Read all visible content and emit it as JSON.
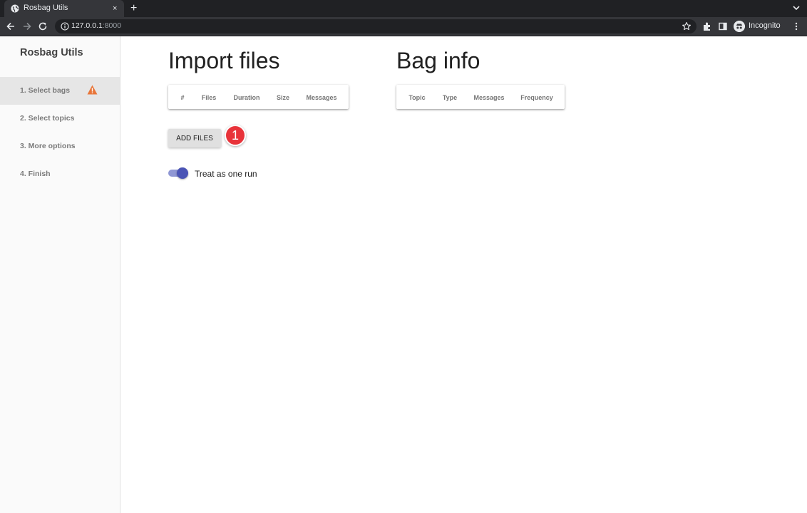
{
  "browser": {
    "tab_title": "Rosbag Utils",
    "tab_close": "×",
    "new_tab": "+",
    "url_host": "127.0.0.1",
    "url_port": ":8000",
    "profile_label": "Incognito"
  },
  "sidebar": {
    "app_title": "Rosbag Utils",
    "steps": [
      {
        "label": "1. Select bags",
        "active": true,
        "warning": true
      },
      {
        "label": "2. Select topics"
      },
      {
        "label": "3. More options"
      },
      {
        "label": "4. Finish"
      }
    ]
  },
  "import": {
    "heading": "Import files",
    "columns": [
      "#",
      "Files",
      "Duration",
      "Size",
      "Messages"
    ],
    "add_button": "ADD FILES",
    "badge_count": "1",
    "toggle_label": "Treat as one run",
    "toggle_on": true
  },
  "bag_info": {
    "heading": "Bag info",
    "columns": [
      "Topic",
      "Type",
      "Messages",
      "Frequency"
    ]
  },
  "colors": {
    "accent": "#4a54b5",
    "warning": "#e8763a",
    "badge": "#e8333a"
  }
}
